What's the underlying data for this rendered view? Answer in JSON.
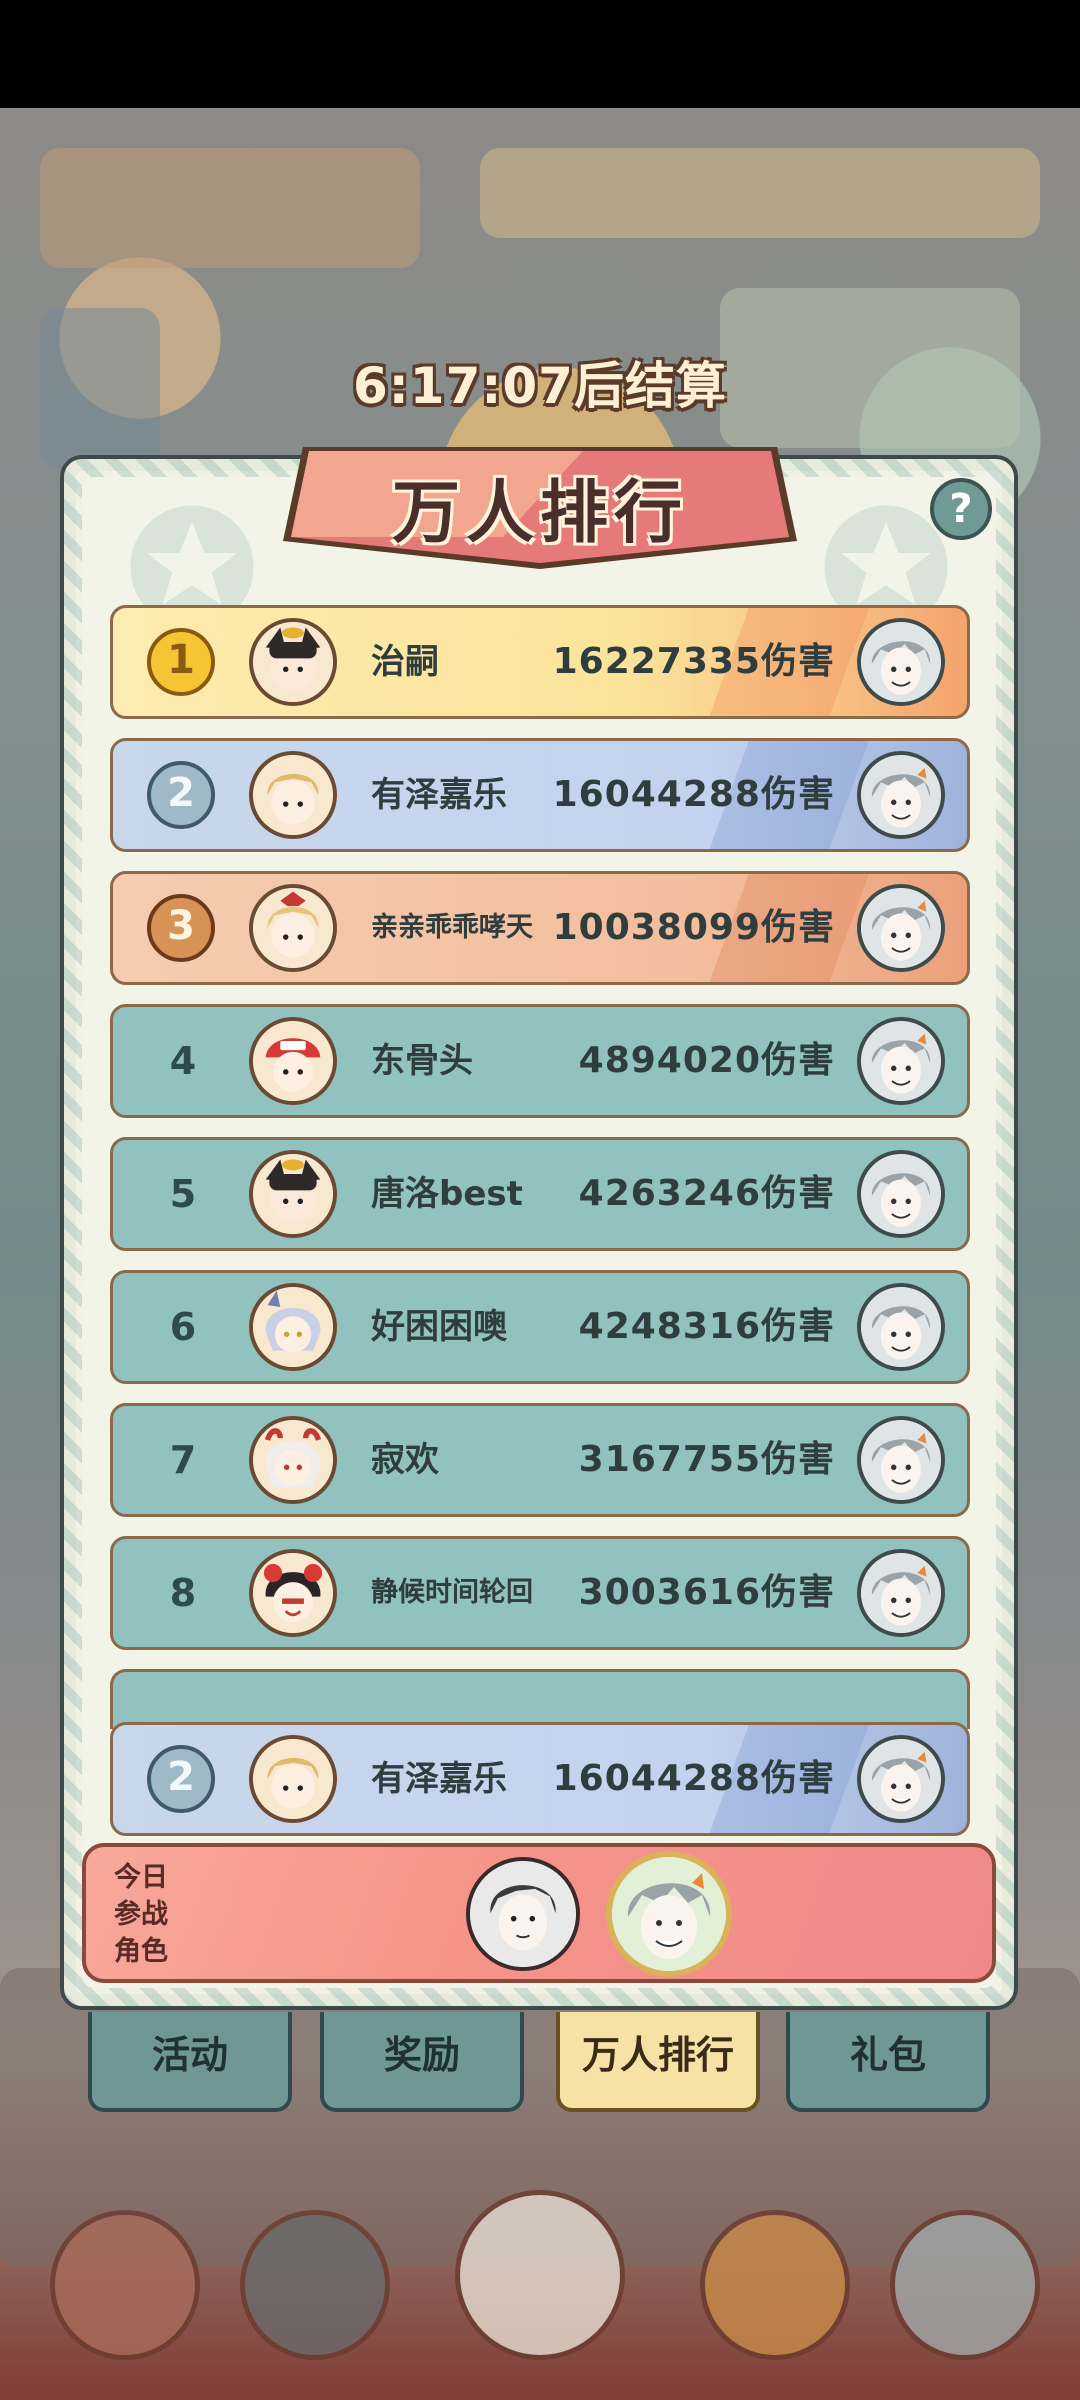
{
  "timer": "6:17:07后结算",
  "title": "万人排行",
  "help_label": "?",
  "rankings": [
    {
      "rank": "1",
      "name": "治嗣",
      "damage": "16227335伤害"
    },
    {
      "rank": "2",
      "name": "有泽嘉乐",
      "damage": "16044288伤害"
    },
    {
      "rank": "3",
      "name": "亲亲乖乖哮天",
      "damage": "10038099伤害"
    },
    {
      "rank": "4",
      "name": "东骨头",
      "damage": "4894020伤害"
    },
    {
      "rank": "5",
      "name": "唐洛best",
      "damage": "4263246伤害"
    },
    {
      "rank": "6",
      "name": "好困困噢",
      "damage": "4248316伤害"
    },
    {
      "rank": "7",
      "name": "寂欢",
      "damage": "3167755伤害"
    },
    {
      "rank": "8",
      "name": "静候时间轮回",
      "damage": "3003616伤害"
    }
  ],
  "my_rank": {
    "rank": "2",
    "name": "有泽嘉乐",
    "damage": "16044288伤害"
  },
  "today": {
    "label": "今日参战角色"
  },
  "tabs": [
    "活动",
    "奖励",
    "万人排行",
    "礼包"
  ],
  "active_tab": "万人排行",
  "colors": {
    "gold": "#fbe39a",
    "silver_blue": "#c3d2ee",
    "bronze": "#f3bd9c",
    "teal": "#91c2bf",
    "today_bar": "#f6958a",
    "active_tab": "#f7e2a6"
  }
}
